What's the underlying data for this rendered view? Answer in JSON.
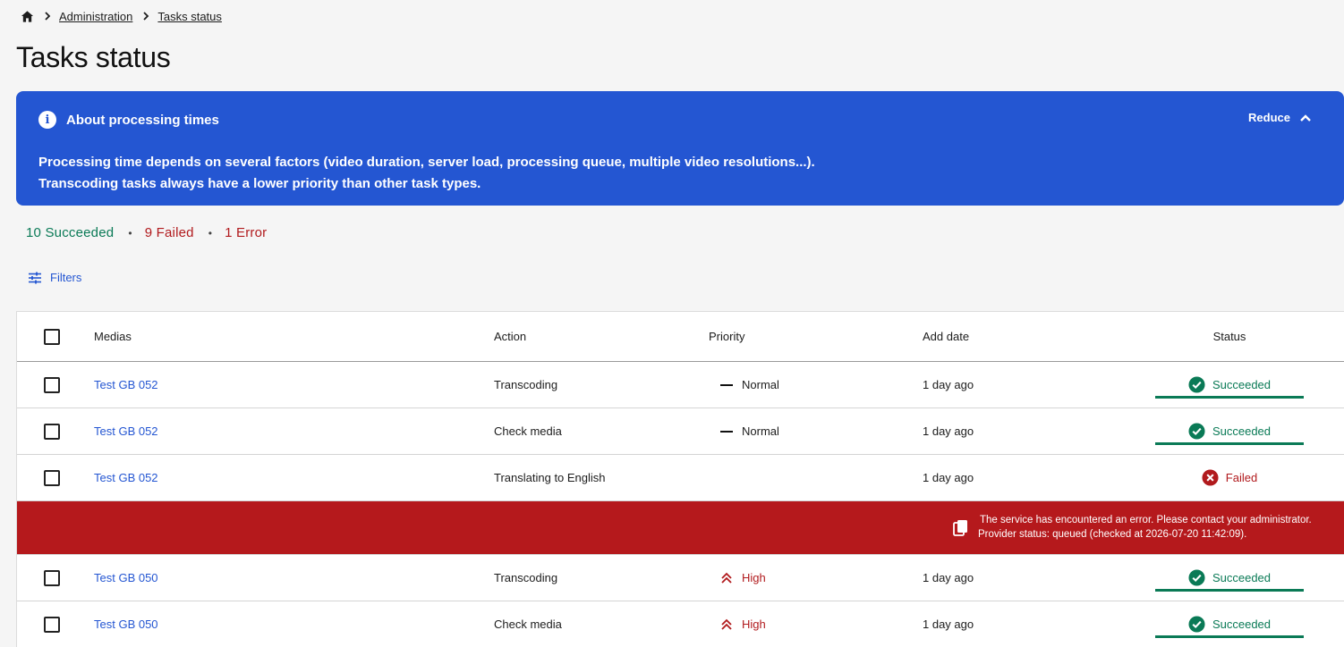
{
  "breadcrumb": {
    "home_icon": "home-icon",
    "items": [
      "Administration",
      "Tasks status"
    ]
  },
  "page": {
    "title": "Tasks status"
  },
  "info_banner": {
    "title": "About processing times",
    "reduce_label": "Reduce",
    "lines": [
      "Processing time depends on several factors (video duration, server load, processing queue, multiple video resolutions...).",
      "Transcoding tasks always have a lower priority than other task types."
    ],
    "color": "#2456d2"
  },
  "summary": {
    "succeeded": "10 Succeeded",
    "failed": "9 Failed",
    "error": "1 Error"
  },
  "filters": {
    "label": "Filters"
  },
  "table": {
    "columns": [
      "Medias",
      "Action",
      "Priority",
      "Add date",
      "Status"
    ],
    "rows": [
      {
        "media": "Test GB 052",
        "action": "Transcoding",
        "priority": "Normal",
        "date": "1 day ago",
        "status": "Succeeded"
      },
      {
        "media": "Test GB 052",
        "action": "Check media",
        "priority": "Normal",
        "date": "1 day ago",
        "status": "Succeeded"
      },
      {
        "media": "Test GB 052",
        "action": "Translating to English",
        "priority": "",
        "date": "1 day ago",
        "status": "Failed"
      },
      {
        "media": "Test GB 050",
        "action": "Transcoding",
        "priority": "High",
        "date": "1 day ago",
        "status": "Succeeded"
      },
      {
        "media": "Test GB 050",
        "action": "Check media",
        "priority": "High",
        "date": "1 day ago",
        "status": "Succeeded"
      }
    ],
    "error": {
      "line1": "The service has encountered an error. Please contact your administrator.",
      "line2": "Provider status: queued (checked at 2026-07-20 11:42:09)."
    }
  },
  "colors": {
    "success": "#0a7a56",
    "danger": "#b11a1d",
    "accent": "#2456d2"
  }
}
